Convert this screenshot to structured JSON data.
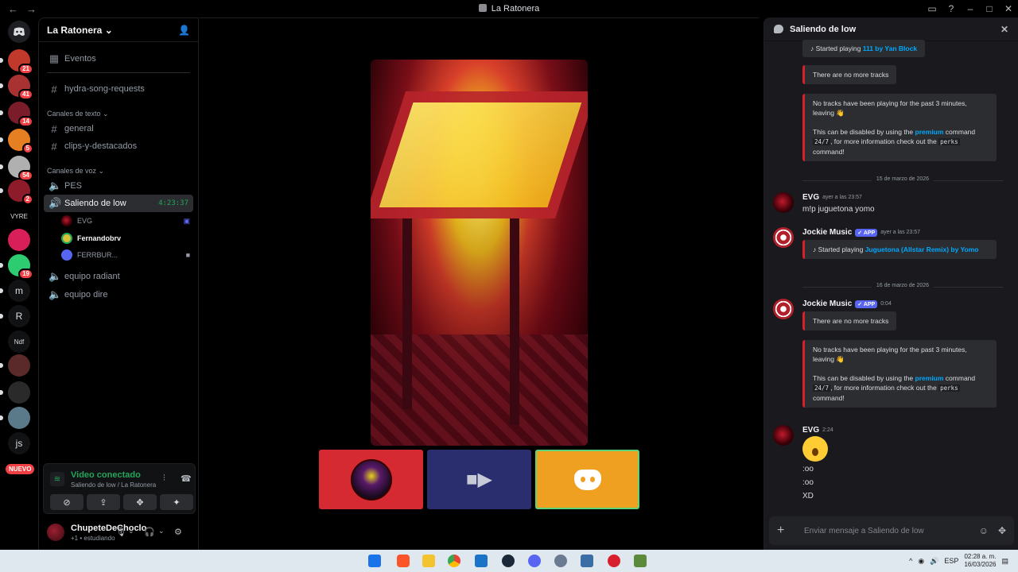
{
  "window": {
    "title": "La Ratonera",
    "nav_back": "←",
    "nav_forward": "→"
  },
  "rail": {
    "servers": [
      {
        "name": "server-1",
        "badge": "21",
        "color": "#c0392b"
      },
      {
        "name": "server-2",
        "badge": "41",
        "color": "#a83232"
      },
      {
        "name": "server-3",
        "badge": "14",
        "color": "#7a1c2a"
      },
      {
        "name": "server-4",
        "badge": "5",
        "color": "#e67e22"
      },
      {
        "name": "server-5",
        "badge": "54",
        "color": "#b0b0b0"
      },
      {
        "name": "server-6",
        "badge": "2",
        "color": "#8e1b2a"
      },
      {
        "name": "server-7",
        "badge": "",
        "label": "VYRE",
        "color": "#000000"
      },
      {
        "name": "server-8",
        "badge": "",
        "color": "#d81f5a"
      },
      {
        "name": "server-9",
        "badge": "19",
        "color": "#2ecc71"
      },
      {
        "name": "server-10",
        "badge": "",
        "label": "m",
        "color": "#111214"
      },
      {
        "name": "server-11",
        "badge": "",
        "label": "R",
        "color": "#111214"
      },
      {
        "name": "server-12",
        "badge": "",
        "label": "Ndf",
        "color": "#111214"
      },
      {
        "name": "server-13",
        "badge": "",
        "color": "#5a2a2a"
      },
      {
        "name": "server-14",
        "badge": "",
        "color": "#2a2a2a"
      },
      {
        "name": "server-15",
        "badge": "",
        "color": "#5a7a8a"
      },
      {
        "name": "server-16",
        "badge": "",
        "label": "js",
        "color": "#111214"
      }
    ],
    "nuevo_label": "NUEVO"
  },
  "sidebar": {
    "guild_name": "La Ratonera",
    "events_label": "Eventos",
    "channel_top": "hydra-song-requests",
    "text_category": "Canales de texto",
    "text_channels": [
      "general",
      "clips-y-destacados"
    ],
    "voice_category": "Canales de voz",
    "voice_channels": {
      "pes": "PES",
      "active": "Saliendo de low",
      "active_timer": "4:23:37",
      "radiant": "equipo radiant",
      "dire": "equipo dire"
    },
    "voice_users": [
      "EVG",
      "Fernandobrv",
      "FERRBUR..."
    ]
  },
  "voice_panel": {
    "status": "Video conectado",
    "channel": "Saliendo de low / La Ratonera"
  },
  "user_panel": {
    "name": "ChupeteDeChoclo",
    "status": "+1 • estudiando"
  },
  "chat": {
    "header": "Saliendo de low",
    "messages": {
      "m1_text": "Started playing ",
      "m1_link": "111 by Yan Block",
      "m2_text": "There are no more tracks",
      "m3_line1": "No tracks have been playing for the past 3 minutes, leaving 👋",
      "m3_line2a": "This can be disabled by using the ",
      "m3_line2_link": "premium",
      "m3_line2b": " command ",
      "m3_code1": "24/7",
      "m3_line2c": ", for more information check out the ",
      "m3_code2": "perks",
      "m3_line2d": " command!",
      "date1": "15 de marzo de 2026",
      "evg1_author": "EVG",
      "evg1_ts": "ayer a las 23:57",
      "evg1_text": "m!p juguetona yomo",
      "jm1_author": "Jockie Music",
      "jm_app": "✓ APP",
      "jm1_ts": "ayer a las 23:57",
      "jm1_text": "Started playing ",
      "jm1_link": "Juguetona (Allstar Remix) by Yomo",
      "date2": "16 de marzo de 2026",
      "jm2_author": "Jockie Music",
      "jm2_ts": "0:04",
      "jm2_text": "There are no more tracks",
      "jm3_line1": "No tracks have been playing for the past 3 minutes, leaving 👋",
      "evg2_author": "EVG",
      "evg2_ts": "2:24",
      "evg2_l1": ":oo",
      "evg2_l2": ":oo",
      "evg2_l3": "XD"
    },
    "composer_placeholder": "Enviar mensaje a Saliendo de low"
  },
  "taskbar": {
    "lang": "ESP",
    "time": "02:28 a. m.",
    "date": "16/03/2026"
  }
}
